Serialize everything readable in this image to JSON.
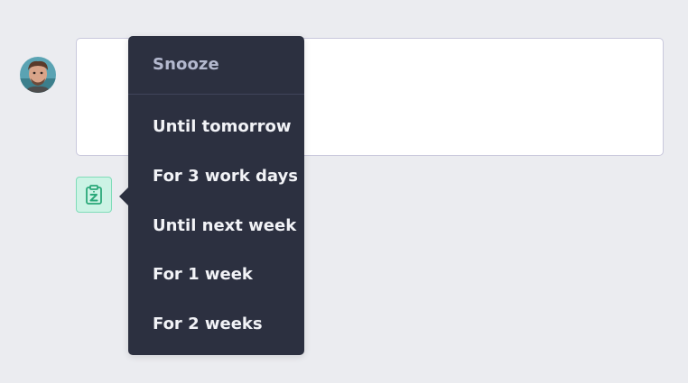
{
  "avatar": {
    "icon": "user-avatar"
  },
  "reply_box": {
    "value": ""
  },
  "snooze_button": {
    "icon": "snooze-clipboard-icon",
    "color": "#2aa879"
  },
  "snooze_menu": {
    "title": "Snooze",
    "items": [
      {
        "label": "Until tomorrow"
      },
      {
        "label": "For 3 work days"
      },
      {
        "label": "Until next week"
      },
      {
        "label": "For 1 week"
      },
      {
        "label": "For 2 weeks"
      }
    ]
  },
  "colors": {
    "background": "#ebecf0",
    "menu_bg": "#2c3040",
    "menu_title": "#b4b9cf",
    "menu_item": "#f2f3f7",
    "accent_green": "#2aa879"
  }
}
